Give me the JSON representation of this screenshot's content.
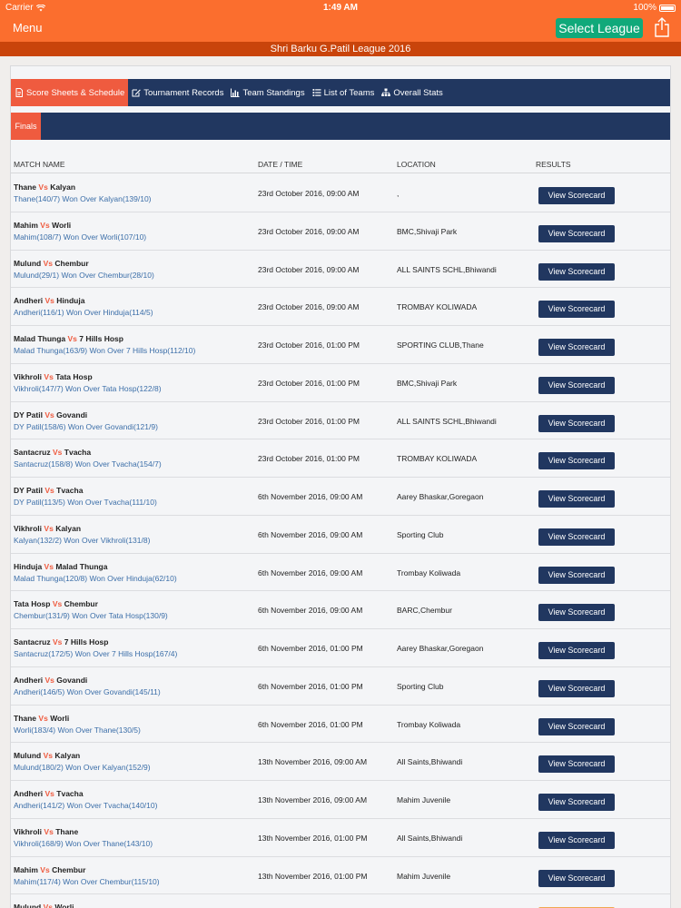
{
  "status_bar": {
    "carrier": "Carrier",
    "time": "1:49 AM",
    "battery": "100%"
  },
  "nav": {
    "menu_label": "Menu",
    "select_league_label": "Select League"
  },
  "league_title": "Shri Barku G.Patil League 2016",
  "tabs": [
    {
      "label": "Score Sheets & Schedule",
      "icon": "document-icon",
      "active": true
    },
    {
      "label": "Tournament Records",
      "icon": "edit-icon",
      "active": false
    },
    {
      "label": "Team Standings",
      "icon": "bar-chart-icon",
      "active": false
    },
    {
      "label": "List of Teams",
      "icon": "list-icon",
      "active": false
    },
    {
      "label": "Overall Stats",
      "icon": "sitemap-icon",
      "active": false
    }
  ],
  "subtab": {
    "label": "Finals"
  },
  "table_headers": {
    "match": "MATCH NAME",
    "datetime": "DATE / TIME",
    "location": "LOCATION",
    "results": "RESULTS"
  },
  "button_label": "View Scorecard",
  "matches": [
    {
      "team_a": "Thane",
      "vs": "Vs",
      "team_b": "Kalyan",
      "result": "Thane(140/7) Won Over Kalyan(139/10)",
      "datetime": "23rd October 2016, 09:00 AM",
      "location": ","
    },
    {
      "team_a": "Mahim",
      "vs": "Vs",
      "team_b": "Worli",
      "result": "Mahim(108/7) Won Over Worli(107/10)",
      "datetime": "23rd October 2016, 09:00 AM",
      "location": "BMC,Shivaji Park"
    },
    {
      "team_a": "Mulund",
      "vs": "Vs",
      "team_b": "Chembur",
      "result": "Mulund(29/1) Won Over Chembur(28/10)",
      "datetime": "23rd October 2016, 09:00 AM",
      "location": "ALL SAINTS SCHL,Bhiwandi"
    },
    {
      "team_a": "Andheri",
      "vs": "Vs",
      "team_b": "Hinduja",
      "result": "Andheri(116/1) Won Over Hinduja(114/5)",
      "datetime": "23rd October 2016, 09:00 AM",
      "location": "TROMBAY KOLIWADA"
    },
    {
      "team_a": "Malad Thunga",
      "vs": "Vs",
      "team_b": "7 Hills Hosp",
      "result": "Malad Thunga(163/9) Won Over 7 Hills Hosp(112/10)",
      "datetime": "23rd October 2016, 01:00 PM",
      "location": "SPORTING CLUB,Thane"
    },
    {
      "team_a": "Vikhroli",
      "vs": "Vs",
      "team_b": "Tata Hosp",
      "result": "Vikhroli(147/7) Won Over Tata Hosp(122/8)",
      "datetime": "23rd October 2016, 01:00 PM",
      "location": "BMC,Shivaji Park"
    },
    {
      "team_a": "DY Patil",
      "vs": "Vs",
      "team_b": "Govandi",
      "result": "DY Patil(158/6) Won Over Govandi(121/9)",
      "datetime": "23rd October 2016, 01:00 PM",
      "location": "ALL SAINTS SCHL,Bhiwandi"
    },
    {
      "team_a": "Santacruz",
      "vs": "Vs",
      "team_b": "Tvacha",
      "result": "Santacruz(158/8) Won Over Tvacha(154/7)",
      "datetime": "23rd October 2016, 01:00 PM",
      "location": "TROMBAY KOLIWADA"
    },
    {
      "team_a": "DY Patil",
      "vs": "Vs",
      "team_b": "Tvacha",
      "result": "DY Patil(113/5) Won Over Tvacha(111/10)",
      "datetime": "6th November 2016, 09:00 AM",
      "location": "Aarey Bhaskar,Goregaon"
    },
    {
      "team_a": "Vikhroli",
      "vs": "Vs",
      "team_b": "Kalyan",
      "result": "Kalyan(132/2) Won Over Vikhroli(131/8)",
      "datetime": "6th November 2016, 09:00 AM",
      "location": "Sporting Club"
    },
    {
      "team_a": "Hinduja",
      "vs": "Vs",
      "team_b": "Malad Thunga",
      "result": "Malad Thunga(120/8) Won Over Hinduja(62/10)",
      "datetime": "6th November 2016, 09:00 AM",
      "location": "Trombay Koliwada"
    },
    {
      "team_a": "Tata Hosp",
      "vs": "Vs",
      "team_b": "Chembur",
      "result": "Chembur(131/9) Won Over Tata Hosp(130/9)",
      "datetime": "6th November 2016, 09:00 AM",
      "location": "BARC,Chembur"
    },
    {
      "team_a": "Santacruz",
      "vs": "Vs",
      "team_b": "7 Hills Hosp",
      "result": "Santacruz(172/5) Won Over 7 Hills Hosp(167/4)",
      "datetime": "6th November 2016, 01:00 PM",
      "location": "Aarey Bhaskar,Goregaon"
    },
    {
      "team_a": "Andheri",
      "vs": "Vs",
      "team_b": "Govandi",
      "result": "Andheri(146/5) Won Over Govandi(145/11)",
      "datetime": "6th November 2016, 01:00 PM",
      "location": "Sporting Club"
    },
    {
      "team_a": "Thane",
      "vs": "Vs",
      "team_b": "Worli",
      "result": "Worli(183/4) Won Over Thane(130/5)",
      "datetime": "6th November 2016, 01:00 PM",
      "location": "Trombay Koliwada"
    },
    {
      "team_a": "Mulund",
      "vs": "Vs",
      "team_b": "Kalyan",
      "result": "Mulund(180/2) Won Over Kalyan(152/9)",
      "datetime": "13th November 2016, 09:00 AM",
      "location": "All Saints,Bhiwandi"
    },
    {
      "team_a": "Andheri",
      "vs": "Vs",
      "team_b": "Tvacha",
      "result": "Andheri(141/2) Won Over Tvacha(140/10)",
      "datetime": "13th November 2016, 09:00 AM",
      "location": "Mahim Juvenile"
    },
    {
      "team_a": "Vikhroli",
      "vs": "Vs",
      "team_b": "Thane",
      "result": "Vikhroli(168/9) Won Over Thane(143/10)",
      "datetime": "13th November 2016, 01:00 PM",
      "location": "All Saints,Bhiwandi"
    },
    {
      "team_a": "Mahim",
      "vs": "Vs",
      "team_b": "Chembur",
      "result": "Mahim(117/4) Won Over Chembur(115/10)",
      "datetime": "13th November 2016, 01:00 PM",
      "location": "Mahim Juvenile"
    },
    {
      "team_a": "Mulund",
      "vs": "Vs",
      "team_b": "Worli",
      "result": "",
      "datetime": "",
      "location": "",
      "button_style": "orange"
    }
  ],
  "colors": {
    "header_orange": "#fb6e2e",
    "title_bar": "#c9440b",
    "navy": "#213760",
    "accent_red": "#ef5b3f",
    "league_button": "#10a97a",
    "result_link": "#3b6ea8"
  }
}
